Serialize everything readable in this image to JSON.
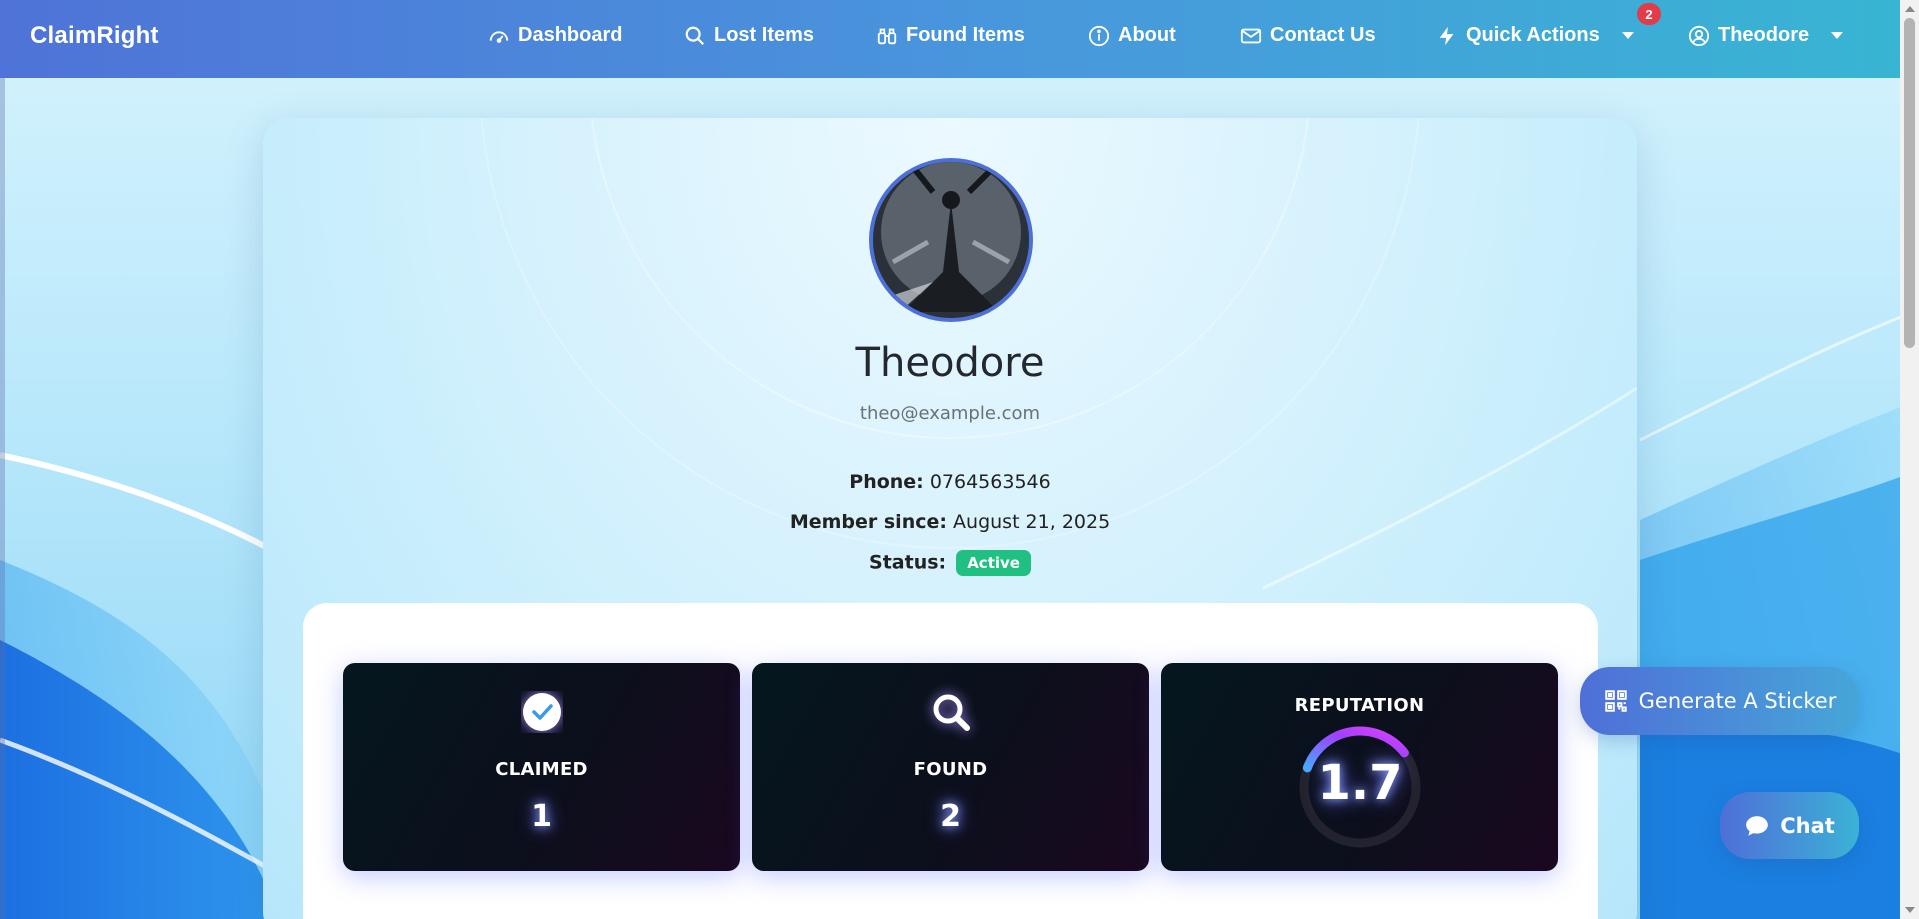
{
  "navbar": {
    "brand": "ClaimRight",
    "items": [
      {
        "label": "Dashboard",
        "icon": "speedometer-icon"
      },
      {
        "label": "Lost Items",
        "icon": "search-icon"
      },
      {
        "label": "Found Items",
        "icon": "binoculars-icon"
      },
      {
        "label": "About",
        "icon": "info-circle-icon"
      },
      {
        "label": "Contact Us",
        "icon": "envelope-icon"
      },
      {
        "label": "Quick Actions",
        "icon": "lightning-icon"
      },
      {
        "label": "Theodore",
        "icon": "user-circle-icon"
      }
    ],
    "notification_count": "2"
  },
  "profile": {
    "name": "Theodore",
    "email": "theo@example.com",
    "phone_label": "Phone:",
    "phone": "0764563546",
    "member_since_label": "Member since:",
    "member_since": "August 21, 2025",
    "status_label": "Status:",
    "status": "Active"
  },
  "stats": {
    "claimed": {
      "label": "CLAIMED",
      "value": "1",
      "icon": "check-circle-icon"
    },
    "found": {
      "label": "FOUND",
      "value": "2",
      "icon": "search-icon"
    },
    "reputation": {
      "label": "REPUTATION",
      "value": "1.7",
      "fraction": 0.34
    }
  },
  "buttons": {
    "sticker": "Generate A Sticker",
    "chat": "Chat"
  },
  "colors": {
    "navbar_start": "#4f73d8",
    "navbar_end": "#38b5d3",
    "active_badge": "#20c083",
    "notification_badge": "#e23b4a",
    "avatar_border": "#4d6fd8"
  }
}
